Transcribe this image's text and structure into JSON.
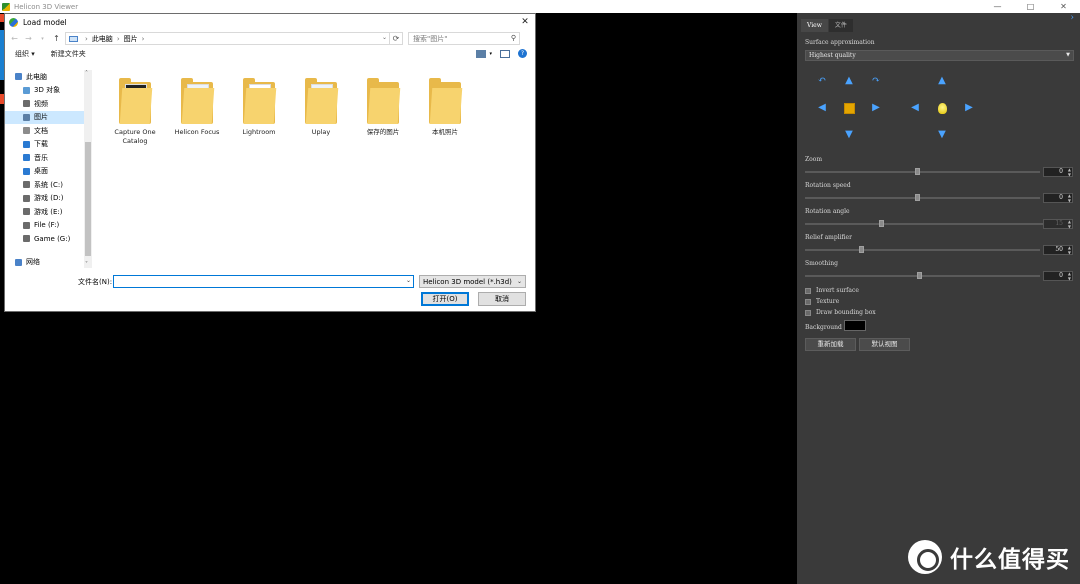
{
  "app": {
    "title": "Helicon 3D Viewer",
    "controls": {
      "minimize": "—",
      "maximize": "□",
      "close": "✕"
    }
  },
  "dialog": {
    "title": "Load model",
    "close": "✕",
    "breadcrumb": [
      "此电脑",
      "图片"
    ],
    "search_placeholder": "搜索\"图片\"",
    "toolbar": {
      "organize": "组织 ▾",
      "new_folder": "新建文件夹"
    },
    "nav": [
      {
        "label": "此电脑",
        "top": true,
        "color": "#4a82c8"
      },
      {
        "label": "3D 对象",
        "color": "#5a9bd5"
      },
      {
        "label": "视频",
        "color": "#6b6b6b"
      },
      {
        "label": "图片",
        "selected": true,
        "color": "#5b7fa6"
      },
      {
        "label": "文档",
        "color": "#8c8c8c"
      },
      {
        "label": "下载",
        "color": "#2a7ad2"
      },
      {
        "label": "音乐",
        "color": "#2a7ad2"
      },
      {
        "label": "桌面",
        "color": "#2a7ad2"
      },
      {
        "label": "系统 (C:)",
        "color": "#6b6b6b"
      },
      {
        "label": "游戏 (D:)",
        "color": "#6b6b6b"
      },
      {
        "label": "游戏 (E:)",
        "color": "#6b6b6b"
      },
      {
        "label": "File (F:)",
        "color": "#6b6b6b"
      },
      {
        "label": "Game (G:)",
        "color": "#6b6b6b"
      },
      {
        "label": "网络",
        "top": true,
        "color": "#4a82c8"
      }
    ],
    "folders": [
      {
        "label": "Capture One Catalog",
        "paper": "dark"
      },
      {
        "label": "Helicon Focus",
        "paper": "light"
      },
      {
        "label": "Lightroom",
        "paper": "white"
      },
      {
        "label": "Uplay",
        "paper": "light"
      },
      {
        "label": "保存的图片",
        "paper": "none"
      },
      {
        "label": "本机照片",
        "paper": "none"
      }
    ],
    "filename_label": "文件名(N):",
    "filename_value": "",
    "filetype": "Helicon 3D model (*.h3d)",
    "open_btn": "打开(O)",
    "cancel_btn": "取消"
  },
  "panel": {
    "tabs": [
      "View",
      "文件"
    ],
    "surface_label": "Surface approximation",
    "quality": "Highest quality",
    "sliders": [
      {
        "label": "Zoom",
        "value": "0",
        "disabled": false
      },
      {
        "label": "Rotation speed",
        "value": "0",
        "disabled": false
      },
      {
        "label": "Rotation angle",
        "value": "15",
        "disabled": true
      },
      {
        "label": "Relief amplifier",
        "value": "50",
        "disabled": false
      },
      {
        "label": "Smoothing",
        "value": "0",
        "disabled": false
      }
    ],
    "checkboxes": [
      "Invert surface",
      "Texture",
      "Draw bounding box"
    ],
    "background_label": "Background",
    "reload_btn": "重新加载",
    "default_view_btn": "默认视图"
  },
  "watermark": {
    "text": "什么值得买"
  },
  "colors": {
    "accent": "#0078d7",
    "panel_bg": "#3a3a3a",
    "arrow_blue": "#4aa3ff"
  }
}
